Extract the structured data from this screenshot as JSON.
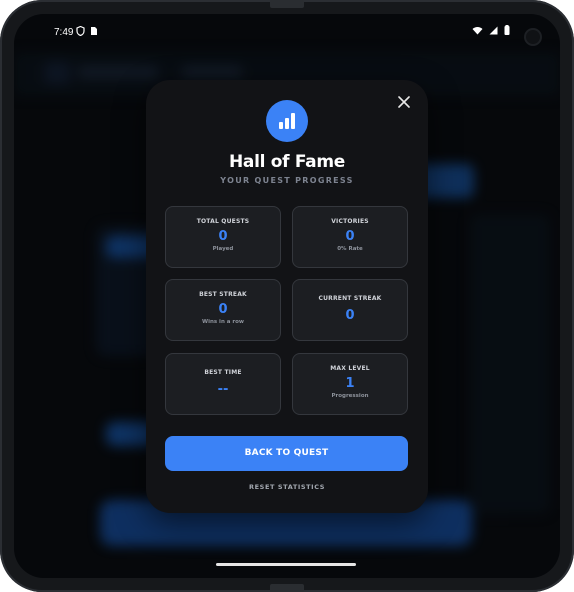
{
  "status_bar": {
    "time": "7:49",
    "left_icons": [
      "shield-icon",
      "sim-icon"
    ],
    "right_icons": [
      "wifi-icon",
      "signal-icon",
      "battery-icon"
    ]
  },
  "modal": {
    "icon": "bar-chart-icon",
    "accent_color": "#3b82f6",
    "title": "Hall of Fame",
    "subtitle": "YOUR QUEST PROGRESS",
    "stats": [
      {
        "label": "TOTAL QUESTS",
        "value": "0",
        "sub": "Played"
      },
      {
        "label": "VICTORIES",
        "value": "0",
        "sub": "0% Rate"
      },
      {
        "label": "BEST STREAK",
        "value": "0",
        "sub": "Wins in a row"
      },
      {
        "label": "CURRENT STREAK",
        "value": "0",
        "sub": ""
      },
      {
        "label": "BEST TIME",
        "value": "--",
        "sub": ""
      },
      {
        "label": "MAX LEVEL",
        "value": "1",
        "sub": "Progression"
      }
    ],
    "primary_button": "BACK TO QUEST",
    "secondary_button": "RESET STATISTICS"
  }
}
